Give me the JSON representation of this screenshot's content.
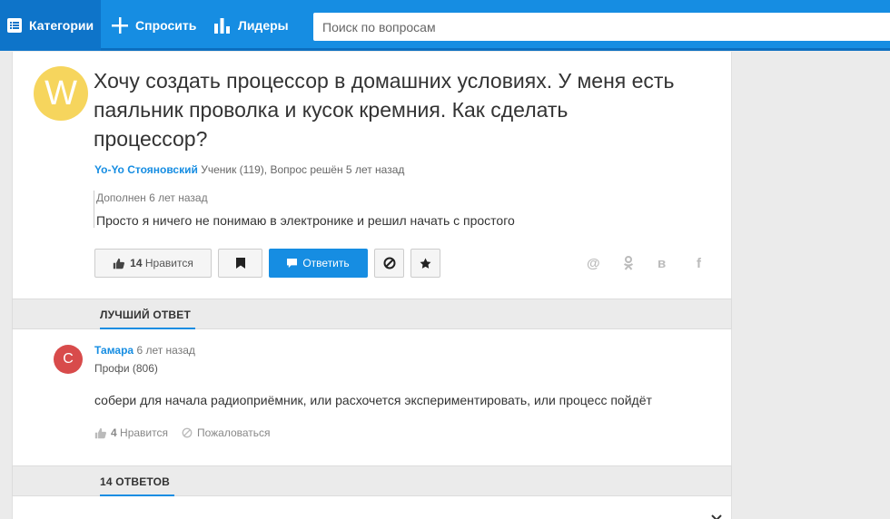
{
  "nav": {
    "categories": "Категории",
    "ask": "Спросить",
    "leaders": "Лидеры",
    "search_placeholder": "Поиск по вопросам"
  },
  "question": {
    "avatar_letter": "W",
    "title": "Хочу создать процессор в домашних условиях. У меня есть паяльник проволка и кусок кремния. Как сделать процессор?",
    "author": "Yo-Yo Стояновский",
    "author_info": " Ученик (119), Вопрос решён 5 лет назад",
    "added_label": "Дополнен 6 лет назад",
    "added_text": "Просто я ничего не понимаю в электронике и решил начать с простого",
    "likes_count": "14",
    "likes_label": "Нравится",
    "reply_label": "Ответить"
  },
  "share": [
    "@",
    "ok",
    "в",
    "f"
  ],
  "best_answer": {
    "section_title": "ЛУЧШИЙ ОТВЕТ",
    "avatar_letter": "С",
    "author": "Тамара",
    "time": " 6 лет назад",
    "rank": "Профи (806)",
    "text": "собери для начала радиоприёмник, или расхочется экспериментировать, или процесс пойдёт",
    "likes_count": "4",
    "likes_label": "Нравится",
    "report_label": "Пожаловаться"
  },
  "answers_section": {
    "title": "14 ОТВЕТОВ"
  },
  "colors": {
    "brand": "#168de2",
    "avatar_w": "#f6d55d",
    "avatar_c": "#d84b4b"
  }
}
